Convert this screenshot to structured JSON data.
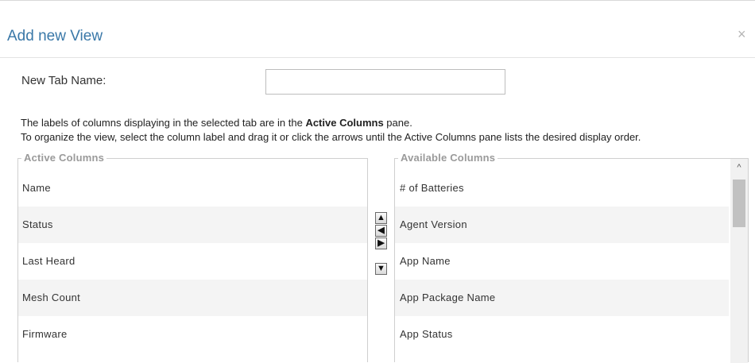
{
  "dialog": {
    "title": "Add new View",
    "close_glyph": "×"
  },
  "tab_name": {
    "label": "New Tab Name:",
    "value": "",
    "placeholder": ""
  },
  "instructions": {
    "line1_prefix": "The labels of columns displaying in the selected tab are in the ",
    "line1_bold": "Active Columns",
    "line1_suffix": " pane.",
    "line2": "To organize the view, select the column label and drag it or click the arrows until the Active Columns pane lists the desired display order."
  },
  "active_columns": {
    "legend": "Active Columns",
    "items": [
      "Name",
      "Status",
      "Last Heard",
      "Mesh Count",
      "Firmware"
    ]
  },
  "available_columns": {
    "legend": "Available Columns",
    "items": [
      "# of Batteries",
      "Agent Version",
      "App Name",
      "App Package Name",
      "App Status"
    ]
  },
  "move_buttons": {
    "up": "▲",
    "left": "◀",
    "right": "▶",
    "down": "▼"
  },
  "scrollbar": {
    "up_glyph": "^"
  },
  "icons": {
    "close": "close-icon",
    "up": "arrow-up-icon",
    "left": "arrow-left-icon",
    "right": "arrow-right-icon",
    "down": "arrow-down-icon"
  }
}
